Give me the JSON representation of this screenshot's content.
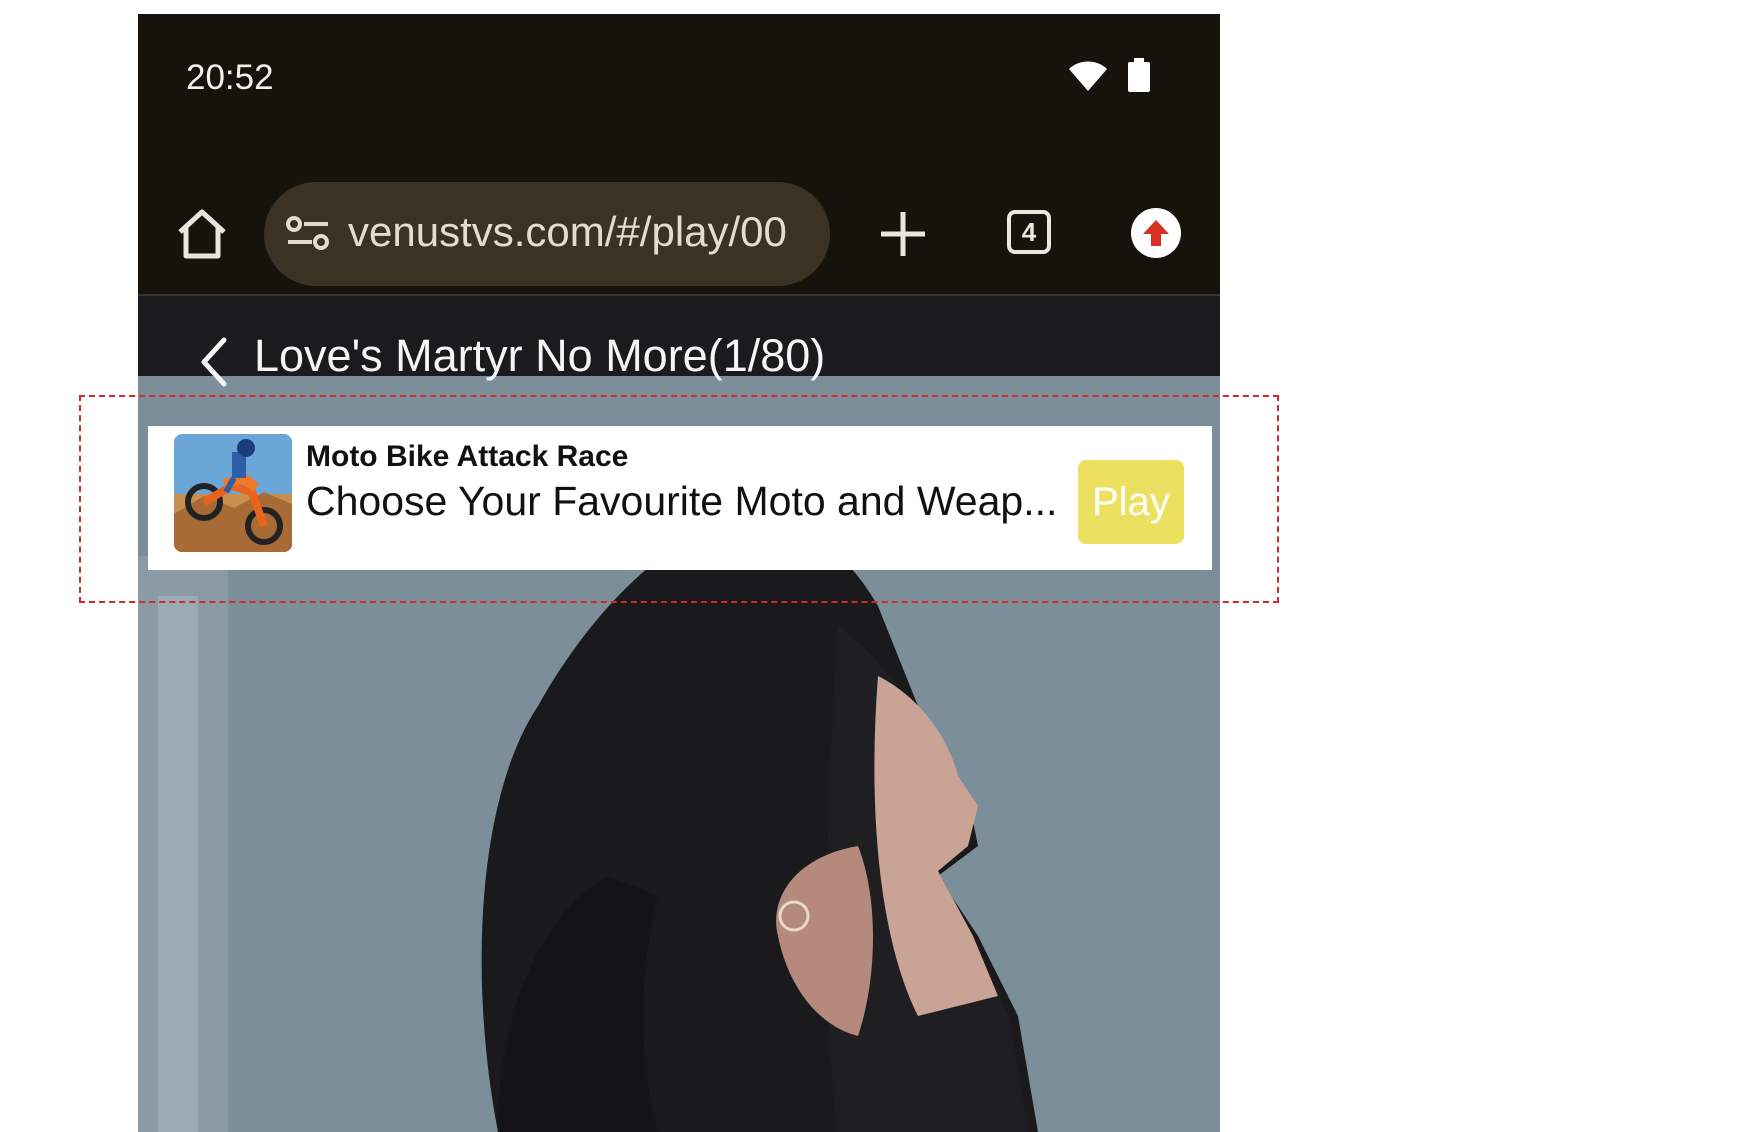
{
  "status_bar": {
    "time": "20:52",
    "icons": [
      "wifi-icon",
      "battery-icon"
    ]
  },
  "browser": {
    "url": "venustvs.com/#/play/00",
    "tab_count": "4",
    "icons": [
      "home-icon",
      "site-settings-icon",
      "plus-icon",
      "tab-switcher-icon",
      "update-arrow-icon"
    ]
  },
  "video": {
    "episode_title": "Love's Martyr No More(1/80)"
  },
  "ad": {
    "title": "Moto Bike Attack Race",
    "description": "Choose Your Favourite Moto and Weap...",
    "play_label": "Play",
    "play_color": "#ece060"
  },
  "colors": {
    "browser_chrome": "#16120c",
    "url_bar": "#3c3224",
    "highlight": "#d12a2a"
  }
}
